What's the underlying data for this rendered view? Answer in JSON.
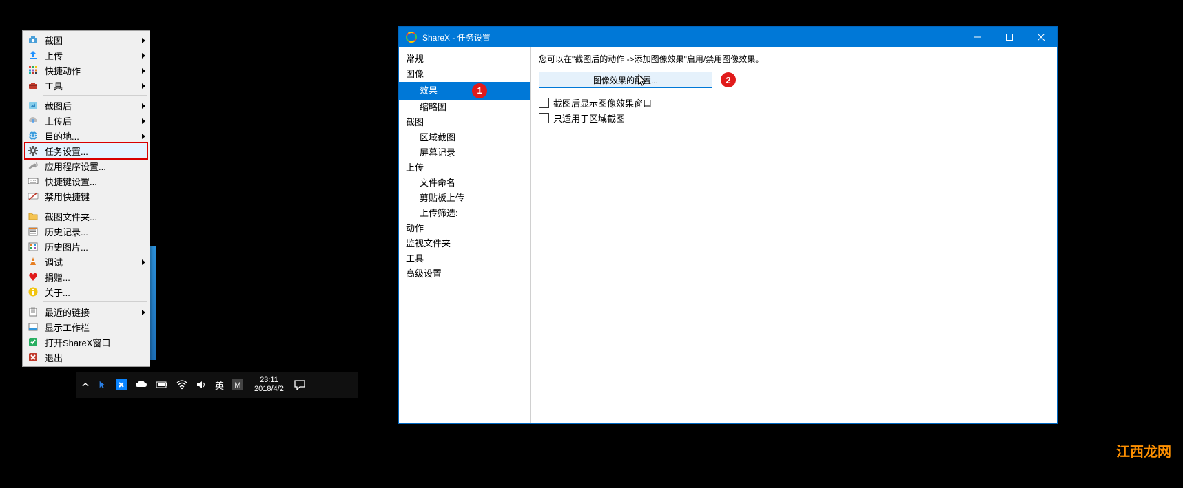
{
  "menu": {
    "items": [
      {
        "label": "截图",
        "arrow": true,
        "icon": "capture"
      },
      {
        "label": "上传",
        "arrow": true,
        "icon": "upload"
      },
      {
        "label": "快捷动作",
        "arrow": true,
        "icon": "grid"
      },
      {
        "label": "工具",
        "arrow": true,
        "icon": "toolbox"
      },
      {
        "sep": true
      },
      {
        "label": "截图后",
        "arrow": true,
        "icon": "after-capture"
      },
      {
        "label": "上传后",
        "arrow": true,
        "icon": "after-upload"
      },
      {
        "label": "目的地...",
        "arrow": true,
        "icon": "globe"
      },
      {
        "label": "任务设置...",
        "arrow": false,
        "icon": "gear",
        "highlight": true
      },
      {
        "label": "应用程序设置...",
        "arrow": false,
        "icon": "wrench"
      },
      {
        "label": "快捷键设置...",
        "arrow": false,
        "icon": "keyboard"
      },
      {
        "label": "禁用快捷键",
        "arrow": false,
        "icon": "no-key"
      },
      {
        "sep": true
      },
      {
        "label": "截图文件夹...",
        "arrow": false,
        "icon": "folder"
      },
      {
        "label": "历史记录...",
        "arrow": false,
        "icon": "history"
      },
      {
        "label": "历史图片...",
        "arrow": false,
        "icon": "images"
      },
      {
        "label": "调试",
        "arrow": true,
        "icon": "cone"
      },
      {
        "label": "捐赠...",
        "arrow": false,
        "icon": "heart"
      },
      {
        "label": "关于...",
        "arrow": false,
        "icon": "info"
      },
      {
        "sep": true
      },
      {
        "label": "最近的链接",
        "arrow": true,
        "icon": "clipboard"
      },
      {
        "label": "显示工作栏",
        "arrow": false,
        "icon": "bar"
      },
      {
        "label": "打开ShareX窗口",
        "arrow": false,
        "icon": "check"
      },
      {
        "label": "退出",
        "arrow": false,
        "icon": "exit"
      }
    ]
  },
  "taskbar": {
    "ime": "英",
    "time": "23:11",
    "date": "2018/4/2"
  },
  "window": {
    "title": "ShareX - 任务设置",
    "tree": [
      {
        "label": "常规",
        "lvl": 0
      },
      {
        "label": "图像",
        "lvl": 0
      },
      {
        "label": "效果",
        "lvl": 1,
        "selected": true
      },
      {
        "label": "缩略图",
        "lvl": 1
      },
      {
        "label": "截图",
        "lvl": 0
      },
      {
        "label": "区域截图",
        "lvl": 1
      },
      {
        "label": "屏幕记录",
        "lvl": 1
      },
      {
        "label": "上传",
        "lvl": 0
      },
      {
        "label": "文件命名",
        "lvl": 1
      },
      {
        "label": "剪贴板上传",
        "lvl": 1
      },
      {
        "label": "上传筛选:",
        "lvl": 1
      },
      {
        "label": "动作",
        "lvl": 0
      },
      {
        "label": "监视文件夹",
        "lvl": 0
      },
      {
        "label": "工具",
        "lvl": 0
      },
      {
        "label": "高级设置",
        "lvl": 0
      }
    ],
    "hint": "您可以在\"截图后的动作 ->添加图像效果\"启用/禁用图像效果。",
    "config_button": "图像效果的配置...",
    "chk1": "截图后显示图像效果窗口",
    "chk2": "只适用于区域截图",
    "callout1": "1",
    "callout2": "2"
  },
  "watermark": "江西龙网"
}
